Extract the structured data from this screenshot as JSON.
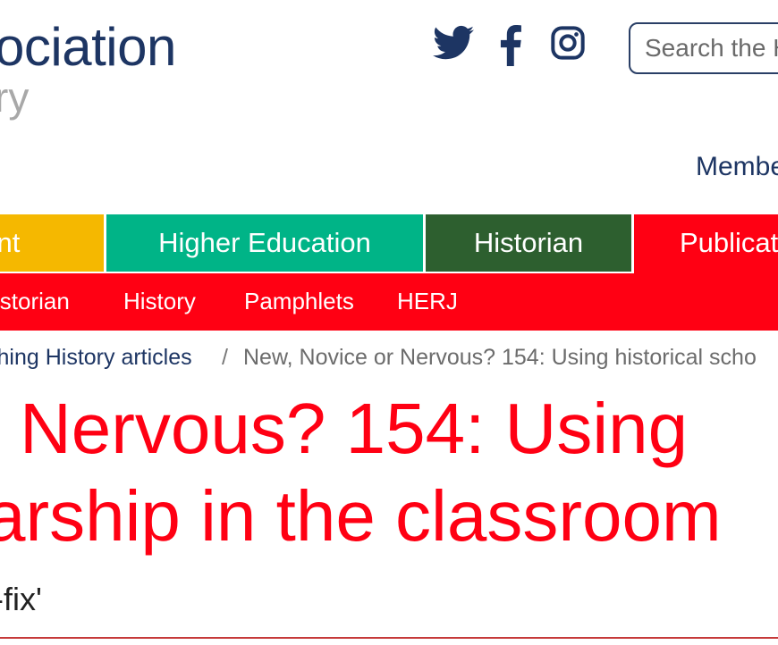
{
  "logo": {
    "line1": "ociation",
    "line2": "ry"
  },
  "social": [
    "twitter-icon",
    "facebook-icon",
    "instagram-icon"
  ],
  "search": {
    "placeholder": "Search the H"
  },
  "member_link": "Membe",
  "nav": {
    "tabs": [
      {
        "label": "dent",
        "color": "#f5b800"
      },
      {
        "label": "Higher Education",
        "color": "#00b487"
      },
      {
        "label": "Historian",
        "color": "#2d5f2f"
      },
      {
        "label": "Publicat",
        "color": "#ff0013"
      }
    ],
    "subnav": [
      "istorian",
      "History",
      "Pamphlets",
      "HERJ"
    ]
  },
  "breadcrumb": {
    "parent": "ching History articles",
    "separator": "/",
    "current": "New, Novice or Nervous? 154: Using historical scho"
  },
  "headline": {
    "line1": "Nervous? 154: Using",
    "line2": "arship in the classroom"
  },
  "subtitle": "-fix'",
  "colors": {
    "brand_navy": "#1d3563",
    "accent_red": "#ff0013"
  }
}
